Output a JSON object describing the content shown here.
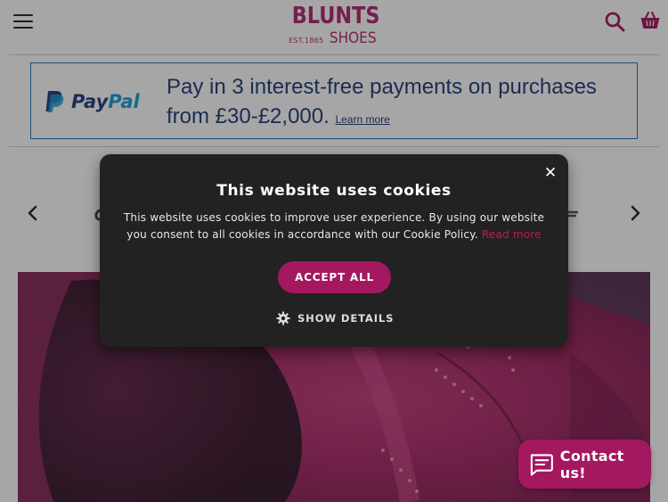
{
  "header": {
    "logo_name": "BLUNTS",
    "logo_est": "EST.1865",
    "logo_shoes": "SHOES"
  },
  "paypal": {
    "logo_text_pay": "Pay",
    "logo_text_pal": "Pal",
    "message": "Pay in 3 interest-free payments on purchases from £30-£2,000.",
    "learn_more": "Learn more"
  },
  "cookie": {
    "title": "This website uses cookies",
    "body": "This website uses cookies to improve user experience. By using our website you consent to all cookies in accordance with our Cookie Policy.",
    "read_more": "Read more",
    "accept_label": "ACCEPT ALL",
    "details_label": "SHOW DETAILS",
    "close_glyph": "✕"
  },
  "contact": {
    "label": "Contact us!"
  },
  "colors": {
    "brand": "#b02670",
    "button": "#a3185f",
    "paypal_dark": "#253b80",
    "paypal_light": "#179bd7",
    "modal_bg": "#222222"
  },
  "icons": [
    "menu-icon",
    "search-icon",
    "basket-icon",
    "paypal-icon",
    "chevron-left-icon",
    "chevron-right-icon",
    "close-icon",
    "gear-icon",
    "chat-icon"
  ]
}
